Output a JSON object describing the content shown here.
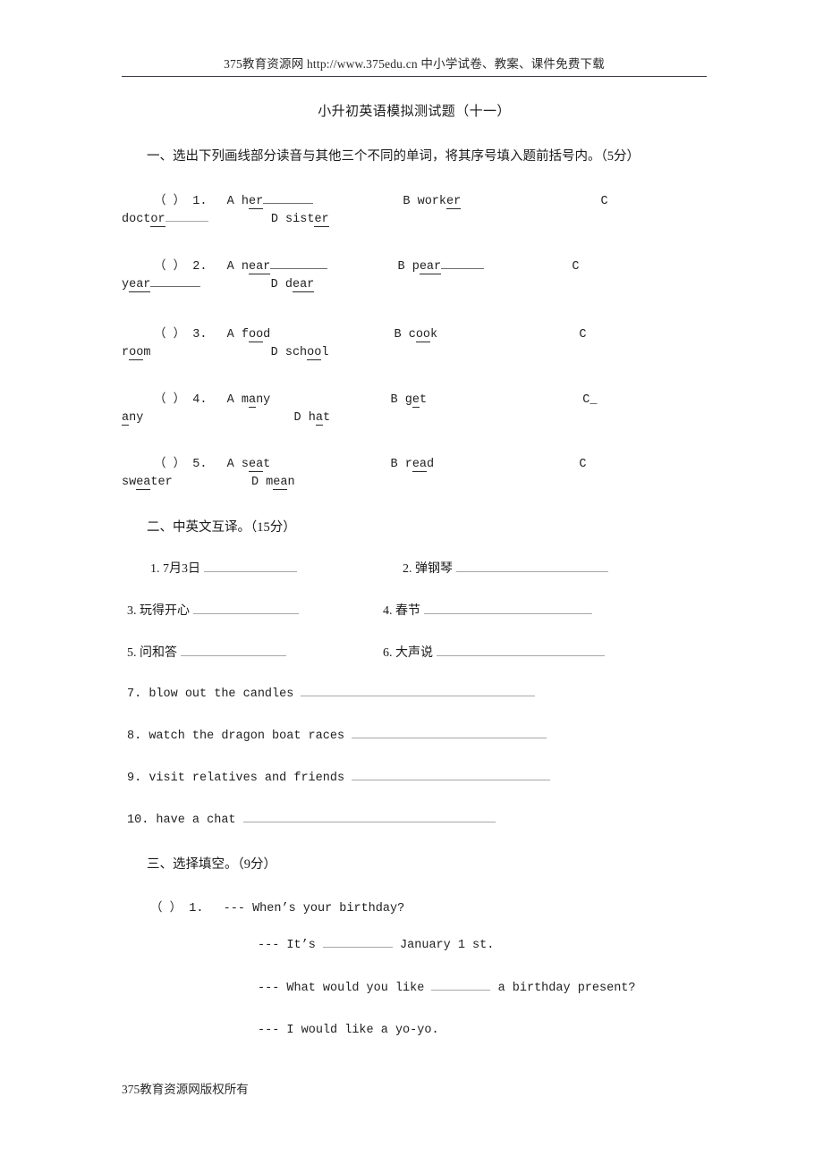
{
  "header": {
    "text": "375教育资源网 http://www.375edu.cn 中小学试卷、教案、课件免费下载"
  },
  "title": "小升初英语模拟测试题（十一）",
  "sections": [
    {
      "id": "section-one",
      "heading": "一、选出下列画线部分读音与其他三个不同的单词，将其序号填入题前括号内。（5分）",
      "items": [
        {
          "bracket": "（  ）",
          "number": "1.",
          "a_label": "A",
          "a_word_pre": "h",
          "a_word_ul": "er",
          "a_tail_blank": true,
          "b_label": "B",
          "b_word_pre": "work",
          "b_word_ul": "er",
          "c_label": "C",
          "c_word_pre": "doct",
          "c_word_ul": "or",
          "c_tail_blank": true,
          "d_label": "D",
          "d_word_pre": "sist",
          "d_word_ul": "er"
        },
        {
          "bracket": "（  ）",
          "number": "2.",
          "a_label": "A",
          "a_word_pre": "n",
          "a_word_ul": "ear",
          "a_tail_blank": true,
          "b_label": "B",
          "b_word_pre": "p",
          "b_word_ul": "ear",
          "b_tail_blank": true,
          "c_label": "C",
          "c_word_pre": "y",
          "c_word_ul": "ear",
          "c_tail_blank": true,
          "d_label": "D",
          "d_word_pre": "d",
          "d_word_ul": "ear"
        },
        {
          "bracket": "（  ）",
          "number": "3.",
          "a_label": "A",
          "a_word_pre": "f",
          "a_word_ul": "oo",
          "a_word_post": "d",
          "b_label": "B",
          "b_word_pre": "c",
          "b_word_ul": "oo",
          "b_word_post": "k",
          "c_label": "C",
          "c_word_pre": "r",
          "c_word_ul": "oo",
          "c_word_post": "m",
          "d_label": "D",
          "d_word_pre": "sch",
          "d_word_ul": "oo",
          "d_word_post": "l"
        },
        {
          "bracket": "（  ）",
          "number": "4.",
          "a_label": "A",
          "a_word_pre": "m",
          "a_word_ul": "a",
          "a_word_post": "ny",
          "b_label": "B",
          "b_word_pre": "g",
          "b_word_ul": "e",
          "b_word_post": "t",
          "c_label": "C_",
          "c_word_pre": "",
          "c_word_ul": "a",
          "c_word_post": "ny",
          "d_label": "D",
          "d_word_pre": "h",
          "d_word_ul": "a",
          "d_word_post": "t"
        },
        {
          "bracket": "（  ）",
          "number": "5.",
          "a_label": "A",
          "a_word_pre": "s",
          "a_word_ul": "ea",
          "a_word_post": "t",
          "b_label": "B",
          "b_word_pre": "r",
          "b_word_ul": "ea",
          "b_word_post": "d",
          "c_label": "C",
          "c_word_pre": "sw",
          "c_word_ul": "ea",
          "c_word_post": "ter",
          "d_label": "D",
          "d_word_pre": "m",
          "d_word_ul": "ea",
          "d_word_post": "n"
        }
      ]
    },
    {
      "id": "section-two",
      "heading": "二、中英文互译。（15分）",
      "cn_items": [
        {
          "number": "1.",
          "text": "7月3日"
        },
        {
          "number": "2.",
          "text": "弹钢琴"
        },
        {
          "number": "3.",
          "text": "玩得开心"
        },
        {
          "number": "4.",
          "text": "春节"
        },
        {
          "number": "5.",
          "text": "问和答"
        },
        {
          "number": "6.",
          "text": "大声说"
        }
      ],
      "en_items": [
        {
          "number": "7.",
          "text": "blow out the candles"
        },
        {
          "number": "8.",
          "text": "watch the dragon boat races"
        },
        {
          "number": "9.",
          "text": "visit relatives and friends"
        },
        {
          "number": "10.",
          "text": "have a chat"
        }
      ]
    },
    {
      "id": "section-three",
      "heading": "三、选择填空。（9分）",
      "question": {
        "bracket": "（  ）",
        "number": "1.",
        "dash": "---",
        "prompt": "When’s your birthday?"
      },
      "dialogue": [
        {
          "dash": "---",
          "pre": "It’s",
          "post": "January 1 st."
        },
        {
          "dash": "---",
          "pre": "What would you like",
          "post": "a birthday present?"
        },
        {
          "dash": "---",
          "pre": "I would like a yo-yo.",
          "post": ""
        }
      ]
    }
  ],
  "footer": "375教育资源网版权所有"
}
